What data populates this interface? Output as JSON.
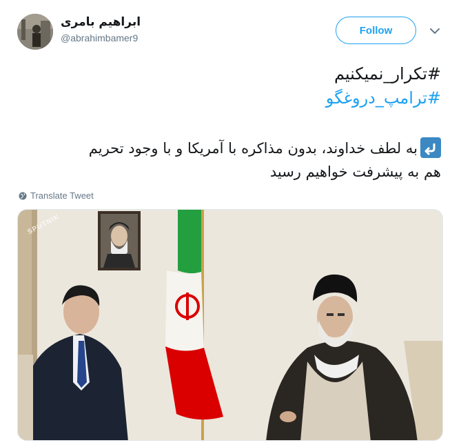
{
  "user": {
    "display_name": "ابراهیم بامری",
    "handle": "@abrahimbamer9"
  },
  "header": {
    "follow_label": "Follow"
  },
  "tweet": {
    "hashtag_1": "#تکرار_نمیکنیم",
    "hashtag_2": "#ترامپ_دروغگو",
    "line_1": "به لطف خداوند، بدون مذاکره با آمریکا و با وجود تحریم",
    "line_2": "هم به پیشرفت خواهیم رسید",
    "translate_label": "Translate Tweet"
  },
  "media": {
    "watermark": "SPUTNIK"
  },
  "colors": {
    "accent": "#1da1f2",
    "text": "#14171a",
    "muted": "#657786"
  },
  "icons": [
    "avatar",
    "chevron-down-icon",
    "return-arrow-icon",
    "globe-icon"
  ]
}
